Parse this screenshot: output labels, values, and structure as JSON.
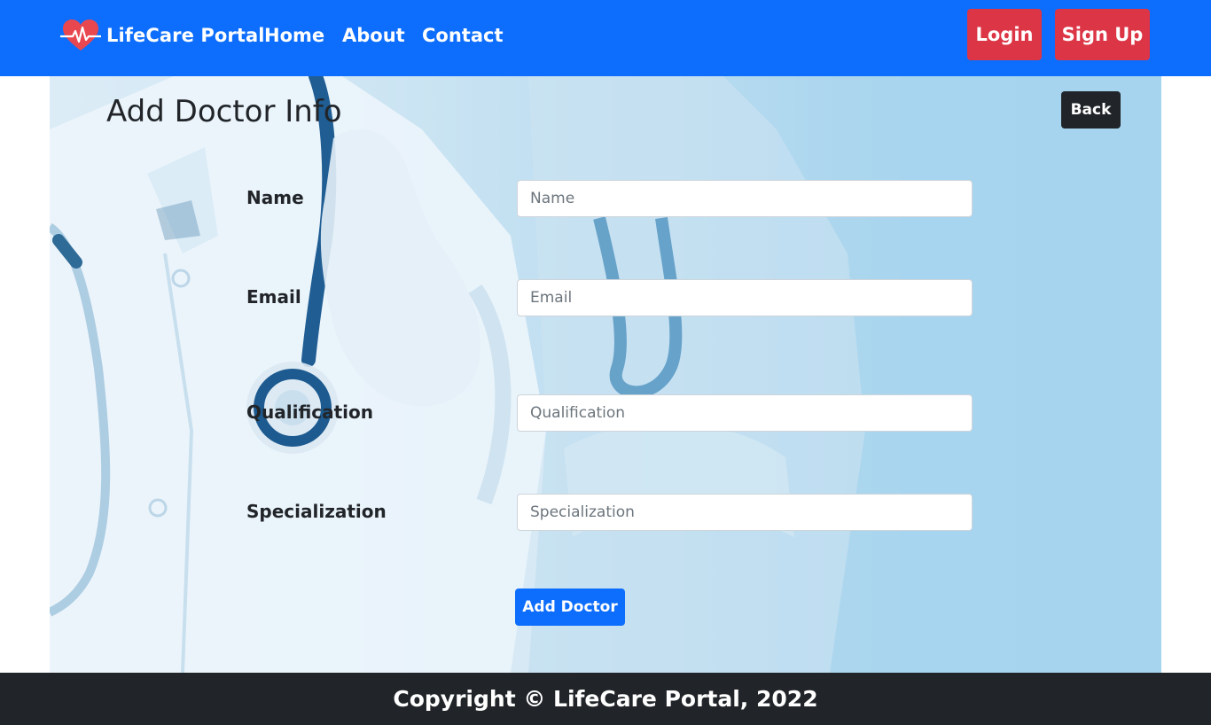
{
  "navbar": {
    "brand_name": "LifeCare Portal",
    "brand_icon": "heart-pulse-icon",
    "links": {
      "home": "Home",
      "about": "About",
      "contact": "Contact"
    },
    "login_label": "Login",
    "signup_label": "Sign Up"
  },
  "page": {
    "title": "Add Doctor Info",
    "back_label": "Back"
  },
  "form": {
    "name": {
      "label": "Name",
      "placeholder": "Name",
      "value": ""
    },
    "email": {
      "label": "Email",
      "placeholder": "Email",
      "value": ""
    },
    "qualification": {
      "label": "Qualification",
      "placeholder": "Qualification",
      "value": ""
    },
    "specialization": {
      "label": "Specialization",
      "placeholder": "Specialization",
      "value": ""
    },
    "submit_label": "Add Doctor"
  },
  "footer": {
    "copyright": "Copyright © LifeCare Portal, 2022"
  },
  "colors": {
    "primary": "#0d6efd",
    "danger": "#dc3545",
    "dark": "#212529"
  }
}
